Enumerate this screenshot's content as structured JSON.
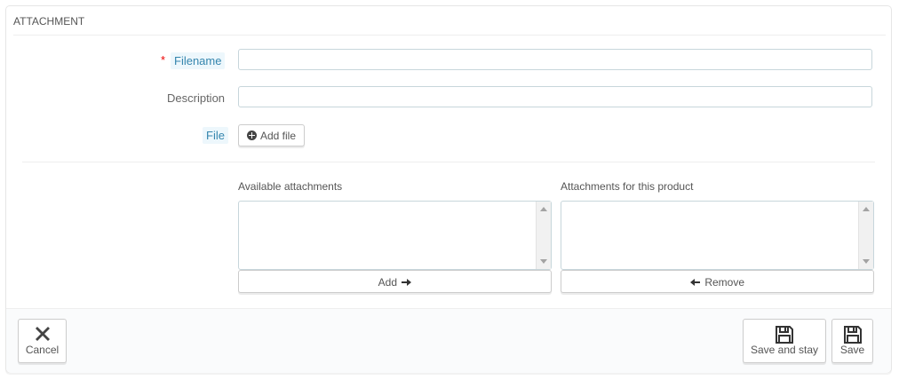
{
  "panel": {
    "title": "ATTACHMENT"
  },
  "form": {
    "filename": {
      "label": "Filename",
      "required_mark": "*",
      "value": ""
    },
    "description": {
      "label": "Description",
      "value": ""
    },
    "file": {
      "label": "File",
      "button": "Add file"
    }
  },
  "attachments": {
    "available_title": "Available attachments",
    "product_title": "Attachments for this product",
    "add_button": "Add",
    "remove_button": "Remove"
  },
  "footer": {
    "cancel": "Cancel",
    "save_and_stay": "Save and stay",
    "save": "Save"
  },
  "colors": {
    "label_accent": "#3586ae",
    "label_bg": "#edf7fc",
    "required": "#e00000"
  }
}
